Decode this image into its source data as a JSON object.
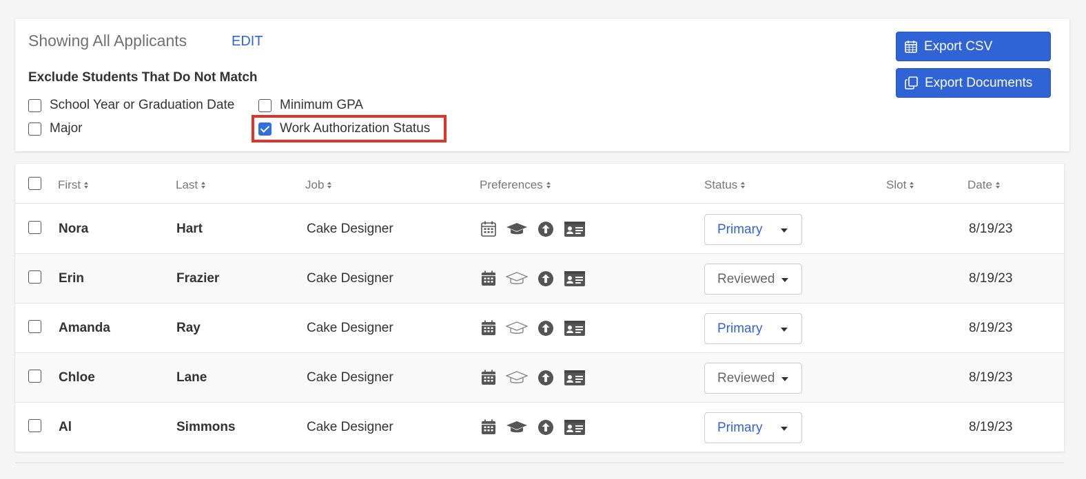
{
  "filters": {
    "title": "Showing All Applicants",
    "edit_label": "EDIT",
    "exclude_heading": "Exclude Students That Do Not Match",
    "options": [
      {
        "label": "School Year or Graduation Date",
        "checked": false
      },
      {
        "label": "Minimum GPA",
        "checked": false
      },
      {
        "label": "Major",
        "checked": false
      },
      {
        "label": "Work Authorization Status",
        "checked": true
      }
    ]
  },
  "actions": {
    "export_csv": "Export CSV",
    "export_documents": "Export Documents"
  },
  "table": {
    "columns": [
      "First",
      "Last",
      "Job",
      "Preferences",
      "Status",
      "Slot",
      "Date"
    ],
    "rows": [
      {
        "first": "Nora",
        "last": "Hart",
        "job": "Cake Designer",
        "status": "Primary",
        "slot": "",
        "date": "8/19/23"
      },
      {
        "first": "Erin",
        "last": "Frazier",
        "job": "Cake Designer",
        "status": "Reviewed",
        "slot": "",
        "date": "8/19/23"
      },
      {
        "first": "Amanda",
        "last": "Ray",
        "job": "Cake Designer",
        "status": "Primary",
        "slot": "",
        "date": "8/19/23"
      },
      {
        "first": "Chloe",
        "last": "Lane",
        "job": "Cake Designer",
        "status": "Reviewed",
        "slot": "",
        "date": "8/19/23"
      },
      {
        "first": "Al",
        "last": "Simmons",
        "job": "Cake Designer",
        "status": "Primary",
        "slot": "",
        "date": "8/19/23"
      }
    ]
  },
  "colors": {
    "accent": "#2f63d6",
    "highlight": "#e0342b"
  }
}
